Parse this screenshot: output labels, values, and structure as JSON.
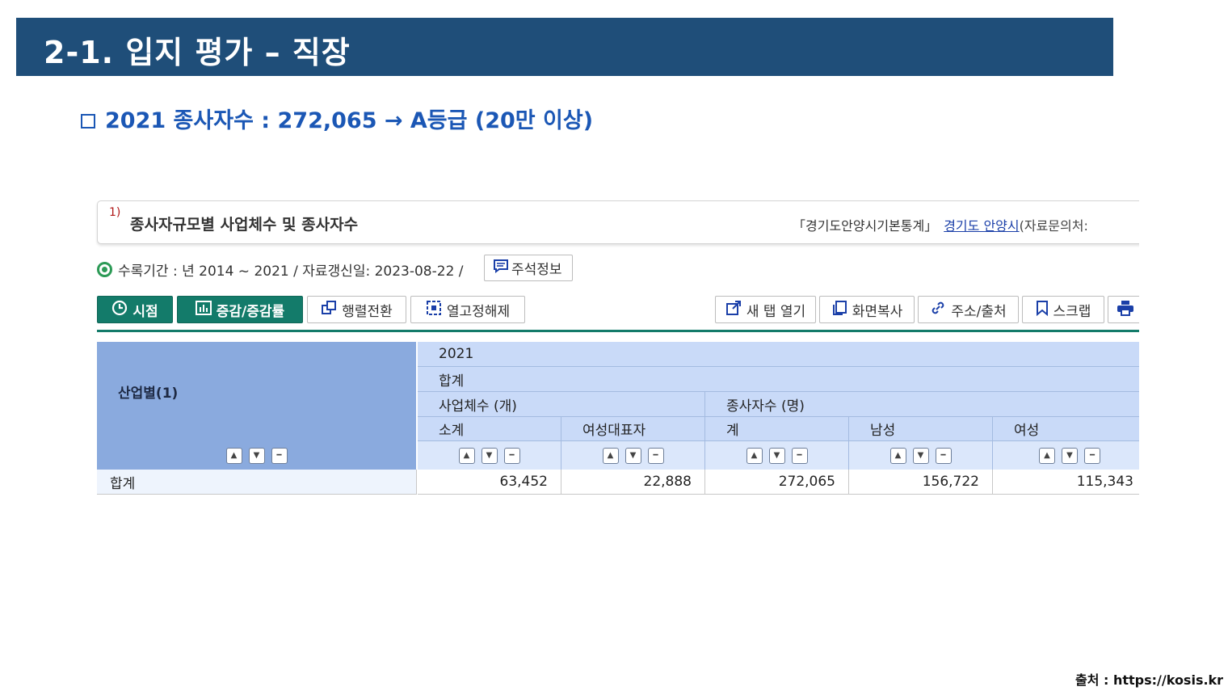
{
  "slide": {
    "title": "2-1. 입지 평가 – 직장",
    "headline": "2021 종사자수 : 272,065 → A등급 (20만 이상)",
    "source_note": "출처 : https://kosis.kr"
  },
  "stat": {
    "footnote_no": "1)",
    "title": "종사자규모별 사업체수 및 종사자수",
    "source_label": "「경기도안양시기본통계」",
    "source_link": "경기도 안양시",
    "source_rest": "(자료문의처:",
    "period": "수록기간 : 년 2014 ~ 2021 / 자료갱신일: 2023-08-22 /",
    "note_button": "주석정보"
  },
  "toolbar": {
    "left": [
      {
        "label": "시점",
        "icon": "clock-icon"
      },
      {
        "label": "증감/증감률",
        "icon": "bar-chart-icon"
      },
      {
        "label": "행렬전환",
        "icon": "swap-icon"
      },
      {
        "label": "열고정해제",
        "icon": "unlock-icon"
      }
    ],
    "right": [
      {
        "label": "새 탭 열기",
        "icon": "new-tab-icon"
      },
      {
        "label": "화면복사",
        "icon": "copy-icon"
      },
      {
        "label": "주소/출처",
        "icon": "link-icon"
      },
      {
        "label": "스크랩",
        "icon": "bookmark-icon"
      },
      {
        "label": "",
        "icon": "print-icon"
      }
    ]
  },
  "table": {
    "row_header": "산업별(1)",
    "year": "2021",
    "total_header": "합계",
    "groups": [
      "사업체수 (개)",
      "종사자수 (명)"
    ],
    "columns": [
      "소계",
      "여성대표자",
      "계",
      "남성",
      "여성"
    ],
    "rows": [
      {
        "label": "합계",
        "values": [
          "63,452",
          "22,888",
          "272,065",
          "156,722",
          "115,343"
        ]
      }
    ]
  },
  "colors": {
    "title_bar": "#1f4e79",
    "headline": "#1b57b5",
    "toolbar_green": "#137b6a",
    "row_header_bg": "#8aaade",
    "col_header_bg": "#c9daf8"
  }
}
